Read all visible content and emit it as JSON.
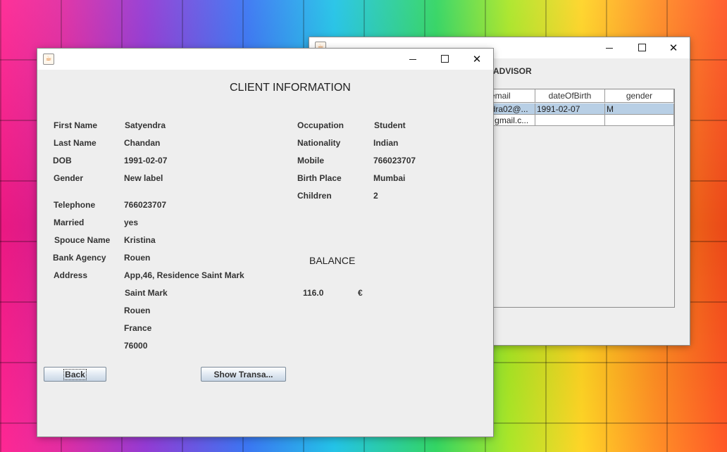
{
  "back_window": {
    "header_label": "ADVISOR",
    "columns": [
      "email",
      "dateOfBirth",
      "gender"
    ],
    "rows": [
      [
        "ndra02@...",
        "1991-02-07",
        "M"
      ],
      [
        "@gmail.c...",
        "",
        ""
      ]
    ]
  },
  "front_window": {
    "heading": "CLIENT INFORMATION",
    "left_fields": [
      {
        "label": "First Name",
        "value": "Satyendra"
      },
      {
        "label": "Last Name",
        "value": "Chandan"
      },
      {
        "label": "DOB",
        "value": "1991-02-07"
      },
      {
        "label": "Gender",
        "value": "New label"
      },
      {
        "label": "Telephone",
        "value": "766023707"
      },
      {
        "label": "Married",
        "value": "yes"
      },
      {
        "label": "Spouce Name",
        "value": "Kristina"
      },
      {
        "label": "Bank Agency",
        "value": "Rouen"
      },
      {
        "label": "Address",
        "value": "App,46, Residence Saint Mark"
      }
    ],
    "address_lines": [
      "Saint Mark",
      "Rouen",
      "France",
      "76000"
    ],
    "right_fields": [
      {
        "label": "Occupation",
        "value": "Student"
      },
      {
        "label": "Nationality",
        "value": "Indian"
      },
      {
        "label": "Mobile",
        "value": "766023707"
      },
      {
        "label": "Birth Place",
        "value": "Mumbai"
      },
      {
        "label": "Children",
        "value": "2"
      }
    ],
    "balance": {
      "title": "BALANCE",
      "amount": "116.0",
      "currency": "€"
    },
    "buttons": {
      "back": "Back",
      "show_transactions": "Show Transa..."
    }
  },
  "window_controls": {
    "minimize": "—",
    "maximize": "☐",
    "close": "✕"
  },
  "icons": {
    "app": "java-cup-icon"
  }
}
